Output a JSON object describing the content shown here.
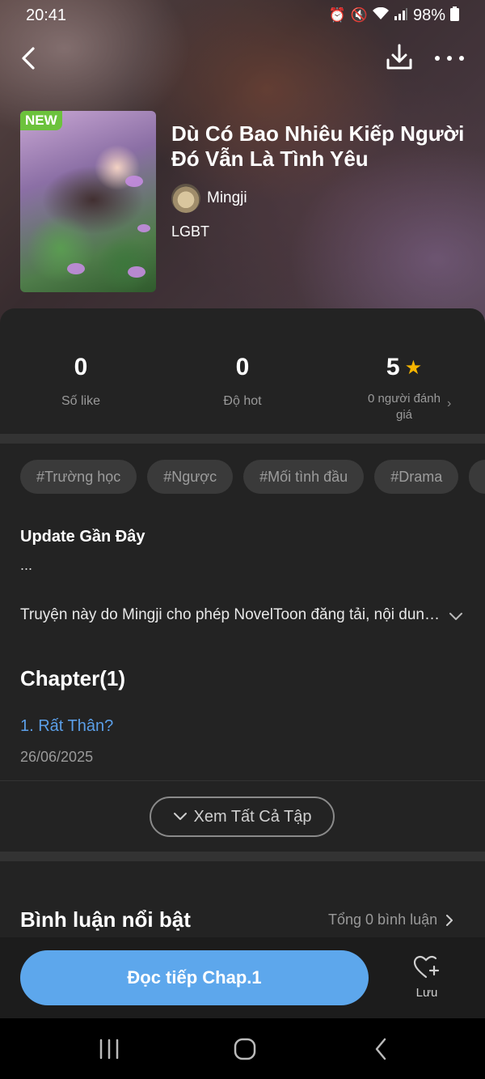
{
  "status_bar": {
    "time": "20:41",
    "battery": "98%",
    "icons": [
      "alarm-icon",
      "mute-icon",
      "wifi-icon",
      "signal-icon",
      "battery-icon"
    ]
  },
  "topbar": {
    "icons": [
      "back-icon",
      "download-icon",
      "more-icon"
    ]
  },
  "book": {
    "badge": "NEW",
    "title": "Dù Có Bao Nhiêu Kiếp Người Đó Vẫn Là Tình Yêu",
    "author": "Mingji",
    "genre": "LGBT"
  },
  "stats": {
    "likes": {
      "value": "0",
      "label": "Số like"
    },
    "hot": {
      "value": "0",
      "label": "Độ hot"
    },
    "rating": {
      "value": "5",
      "label": "0 người đánh giá"
    }
  },
  "tags": [
    "#Trường học",
    "#Ngược",
    "#Mối tình đầu",
    "#Drama"
  ],
  "update": {
    "heading": "Update Gần Đây",
    "content": "..."
  },
  "description": "Truyện này do Mingji cho phép NovelToon đăng tải, nội dung truyện",
  "chapters": {
    "heading": "Chapter(1)",
    "items": [
      {
        "title": "1. Rất Thân?",
        "date": "26/06/2025"
      }
    ],
    "see_all_label": "Xem Tất Cả Tập"
  },
  "comments": {
    "heading": "Bình luận nổi bật",
    "total_label": "Tổng 0 bình luận"
  },
  "bottom": {
    "read_label": "Đọc tiếp Chap.1",
    "save_label": "Lưu"
  },
  "colors": {
    "accent": "#5da7ec",
    "link": "#5b9fe8",
    "badge": "#6cc23c",
    "star": "#f7b500",
    "background": "#232323"
  }
}
